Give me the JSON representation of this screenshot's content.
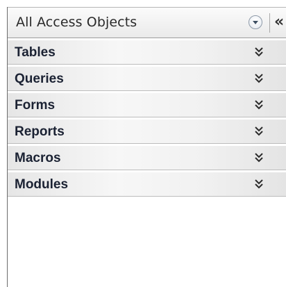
{
  "header": {
    "title": "All Access Objects",
    "dropdown_icon": "chevron-circle-down-icon",
    "collapse_glyph": "«"
  },
  "groups": [
    {
      "label": "Tables",
      "icon": "double-chevron-down-icon"
    },
    {
      "label": "Queries",
      "icon": "double-chevron-down-icon"
    },
    {
      "label": "Forms",
      "icon": "double-chevron-down-icon"
    },
    {
      "label": "Reports",
      "icon": "double-chevron-down-icon"
    },
    {
      "label": "Macros",
      "icon": "double-chevron-down-icon"
    },
    {
      "label": "Modules",
      "icon": "double-chevron-down-icon"
    }
  ],
  "colors": {
    "group_text": "#1b2233",
    "header_text": "#2a2a2a"
  }
}
